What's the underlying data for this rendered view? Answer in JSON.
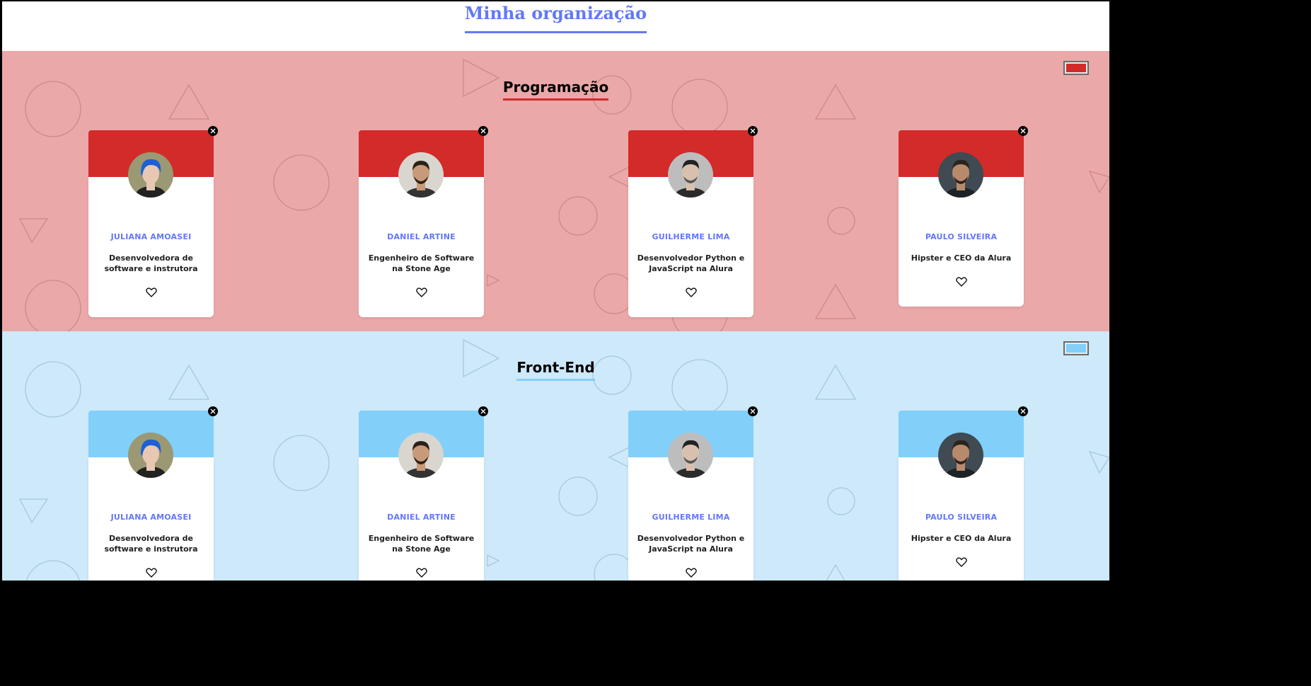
{
  "app_title": "Minha organização",
  "teams": [
    {
      "name": "Programação",
      "primary_color": "#d32a2a",
      "background_color": "#eba8a8",
      "members": [
        {
          "name": "JULIANA AMOASEI",
          "role": "Desenvolvedora de software e instrutora",
          "favorite_icon": "heart-outline-icon",
          "hair": "#1c5fd6",
          "skin": "#e8c7b3"
        },
        {
          "name": "DANIEL ARTINE",
          "role": "Engenheiro de Software na Stone Age",
          "favorite_icon": "heart-outline-icon",
          "hair": "#2a2118",
          "skin": "#c79a7a"
        },
        {
          "name": "GUILHERME LIMA",
          "role": "Desenvolvedor Python e JavaScript na Alura",
          "favorite_icon": "heart-outline-icon",
          "hair": "#222",
          "skin": "#d9c0ae"
        },
        {
          "name": "PAULO SILVEIRA",
          "role": "Hipster e CEO da Alura",
          "favorite_icon": "heart-outline-icon",
          "hair": "#2a231d",
          "skin": "#b88a6c"
        }
      ]
    },
    {
      "name": "Front-End",
      "primary_color": "#82cffa",
      "background_color": "#cde9fa",
      "members": [
        {
          "name": "JULIANA AMOASEI",
          "role": "Desenvolvedora de software e instrutora",
          "favorite_icon": "heart-outline-icon",
          "hair": "#1c5fd6",
          "skin": "#e8c7b3"
        },
        {
          "name": "DANIEL ARTINE",
          "role": "Engenheiro de Software na Stone Age",
          "favorite_icon": "heart-outline-icon",
          "hair": "#2a2118",
          "skin": "#c79a7a"
        },
        {
          "name": "GUILHERME LIMA",
          "role": "Desenvolvedor Python e JavaScript na Alura",
          "favorite_icon": "heart-outline-icon",
          "hair": "#222",
          "skin": "#d9c0ae"
        },
        {
          "name": "PAULO SILVEIRA",
          "role": "Hipster e CEO da Alura",
          "favorite_icon": "heart-outline-icon",
          "hair": "#2a231d",
          "skin": "#b88a6c"
        }
      ]
    }
  ],
  "colors": {
    "accent": "#6278f7"
  }
}
